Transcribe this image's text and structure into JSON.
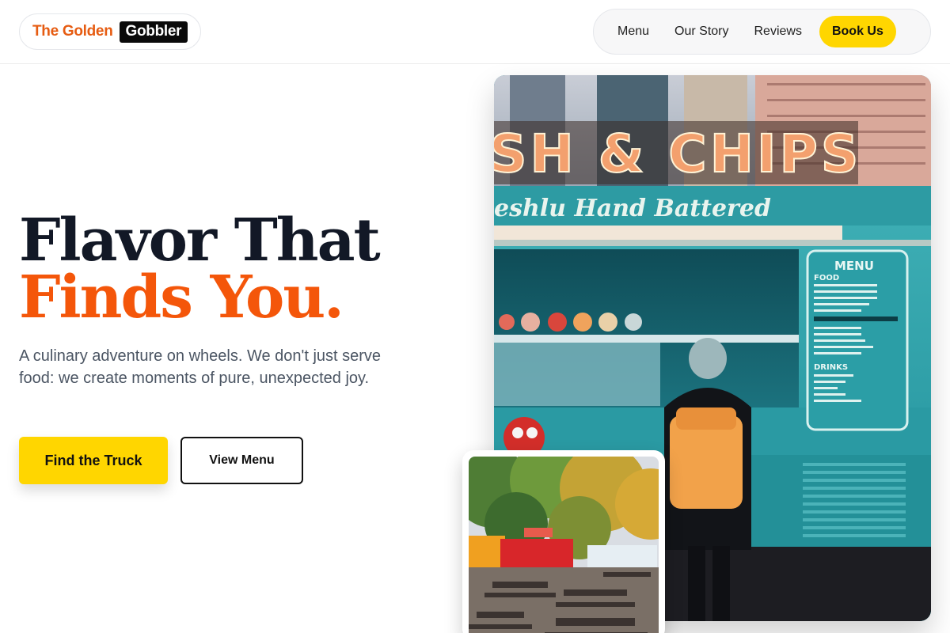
{
  "brand": {
    "part1": "The Golden",
    "part2": "Gobbler"
  },
  "nav": {
    "items": [
      "Menu",
      "Our Story",
      "Reviews"
    ],
    "cta": "Book Us"
  },
  "hero": {
    "title_line1": "Flavor That",
    "title_line2": "Finds You.",
    "subtitle": "A culinary adventure on wheels. We don't just serve food: we create moments of pure, unexpected joy.",
    "primary_button": "Find the Truck",
    "secondary_button": "View Menu"
  },
  "photo_main": {
    "sign": "SH & CHIPS",
    "script": "eshlu Hand Battered",
    "menu_heading": "MENU",
    "menu_food": "FOOD",
    "menu_drinks": "DRINKS"
  },
  "colors": {
    "accent_orange": "#f4560a",
    "accent_yellow": "#ffd600",
    "dark": "#121826"
  }
}
